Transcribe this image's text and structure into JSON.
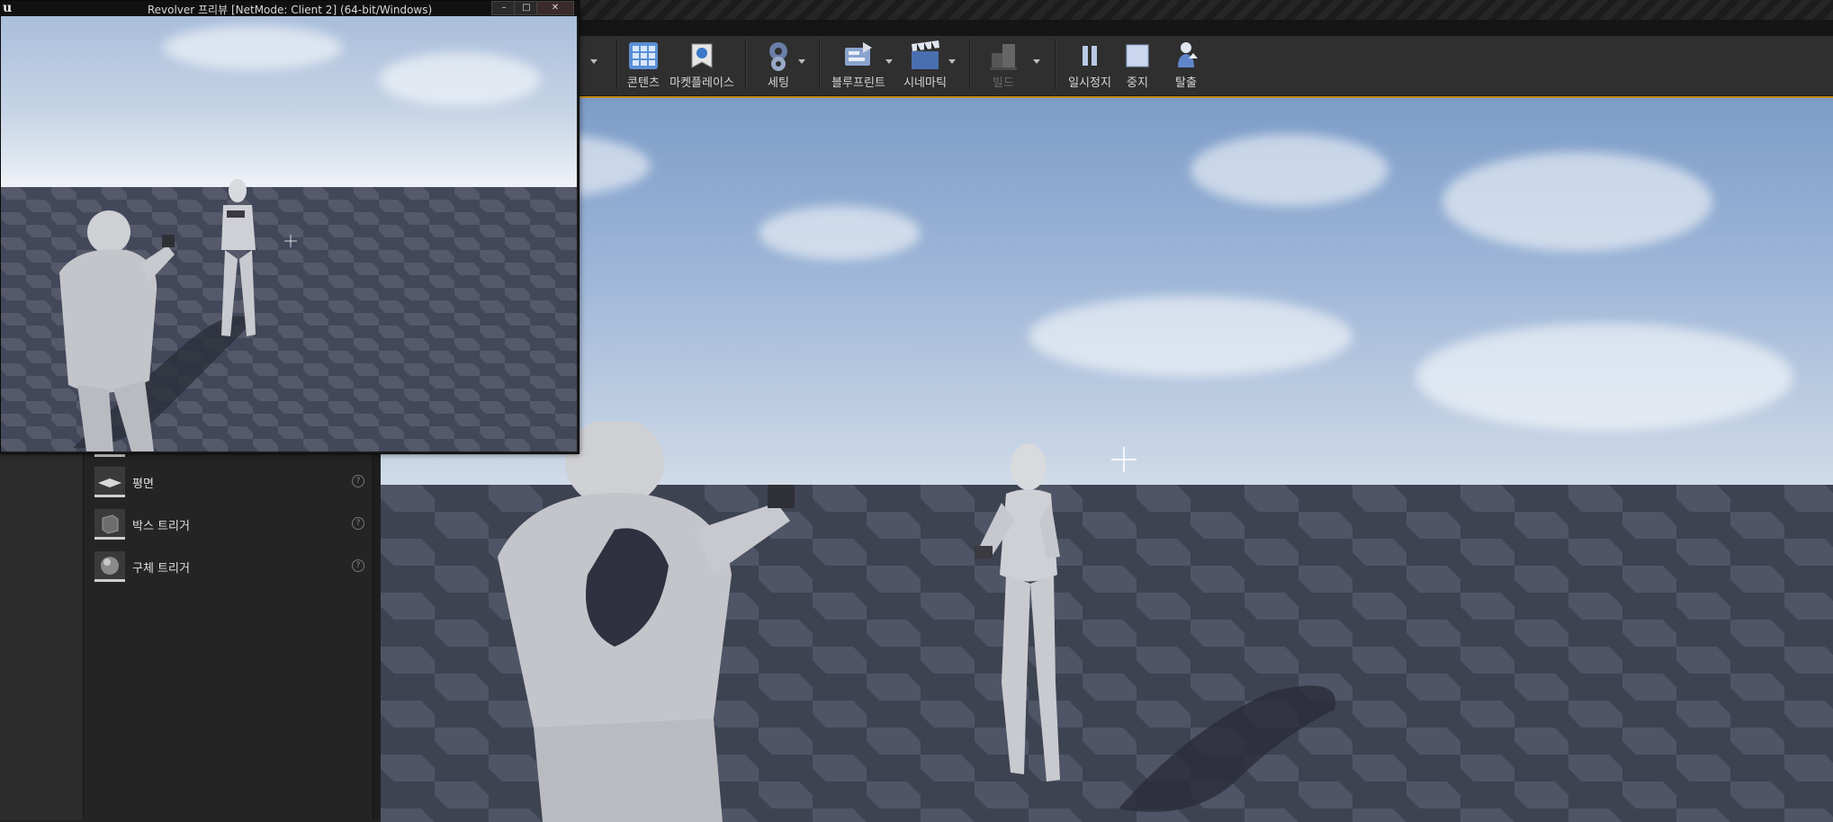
{
  "pie_window": {
    "title": "Revolver 프리뷰 [NetMode: Client 2] (64-bit/Windows)",
    "logo": "u",
    "minimize": "–",
    "maximize": "□",
    "close": "✕"
  },
  "toolbar": {
    "buttons": [
      {
        "label": "콘텐츠",
        "icon": "content-browser-icon"
      },
      {
        "label": "마켓플레이스",
        "icon": "marketplace-icon"
      },
      {
        "label": "세팅",
        "icon": "settings-gear-icon"
      },
      {
        "label": "블루프린트",
        "icon": "blueprint-icon"
      },
      {
        "label": "시네마틱",
        "icon": "cinematics-clapper-icon"
      },
      {
        "label": "빌드",
        "icon": "build-icon"
      },
      {
        "label": "일시정지",
        "icon": "pause-icon"
      },
      {
        "label": "중지",
        "icon": "stop-icon"
      },
      {
        "label": "탈출",
        "icon": "eject-icon"
      }
    ]
  },
  "place_panel": {
    "items": [
      {
        "label": "평면",
        "icon": "plane-icon",
        "help": "?"
      },
      {
        "label": "박스 트리거",
        "icon": "box-trigger-icon",
        "help": "?"
      },
      {
        "label": "구체 트리거",
        "icon": "sphere-trigger-icon",
        "help": "?"
      }
    ]
  },
  "colors": {
    "viewport_border": "#c48a16",
    "toolbar_bg": "#2f2f2f",
    "panel_bg": "#242424"
  }
}
